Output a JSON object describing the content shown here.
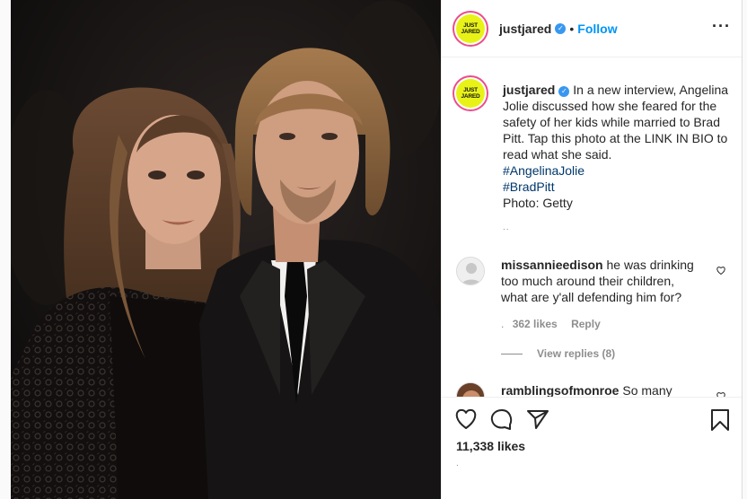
{
  "colors": {
    "follow_blue": "#0095f6",
    "hashtag_blue": "#00376b",
    "verified_blue": "#3897f0",
    "meta_gray": "#8e8e8e",
    "avatar_yellow": "#e8f217",
    "avatar_ring": "#ec4d8b"
  },
  "header": {
    "username": "justjared",
    "separator": "•",
    "follow_label": "Follow",
    "more_icon": "more-horizontal-icon",
    "avatar_line1": "JUST",
    "avatar_line2": "JARED"
  },
  "caption": {
    "username": "justjared",
    "text": "In a new interview, Angelina Jolie discussed how she feared for the safety of her kids while married to Brad Pitt. Tap this photo at the LINK IN BIO to read what she said.",
    "hashtags": [
      "#AngelinaJolie",
      "#BradPitt"
    ],
    "credit": "Photo: Getty",
    "timestamp": ".."
  },
  "comments": [
    {
      "username": "missannieedison",
      "text": "he was drinking too much around their children, what are y'all defending him for?",
      "timestamp": ".",
      "likes": "362 likes",
      "reply_label": "Reply",
      "view_replies": "View replies (8)"
    },
    {
      "username": "ramblingsofmonroe",
      "text": "So many"
    }
  ],
  "actions": {
    "icons": [
      "heart-icon",
      "comment-icon",
      "share-icon",
      "bookmark-icon"
    ],
    "likes": "11,338 likes",
    "date_hint": "."
  }
}
